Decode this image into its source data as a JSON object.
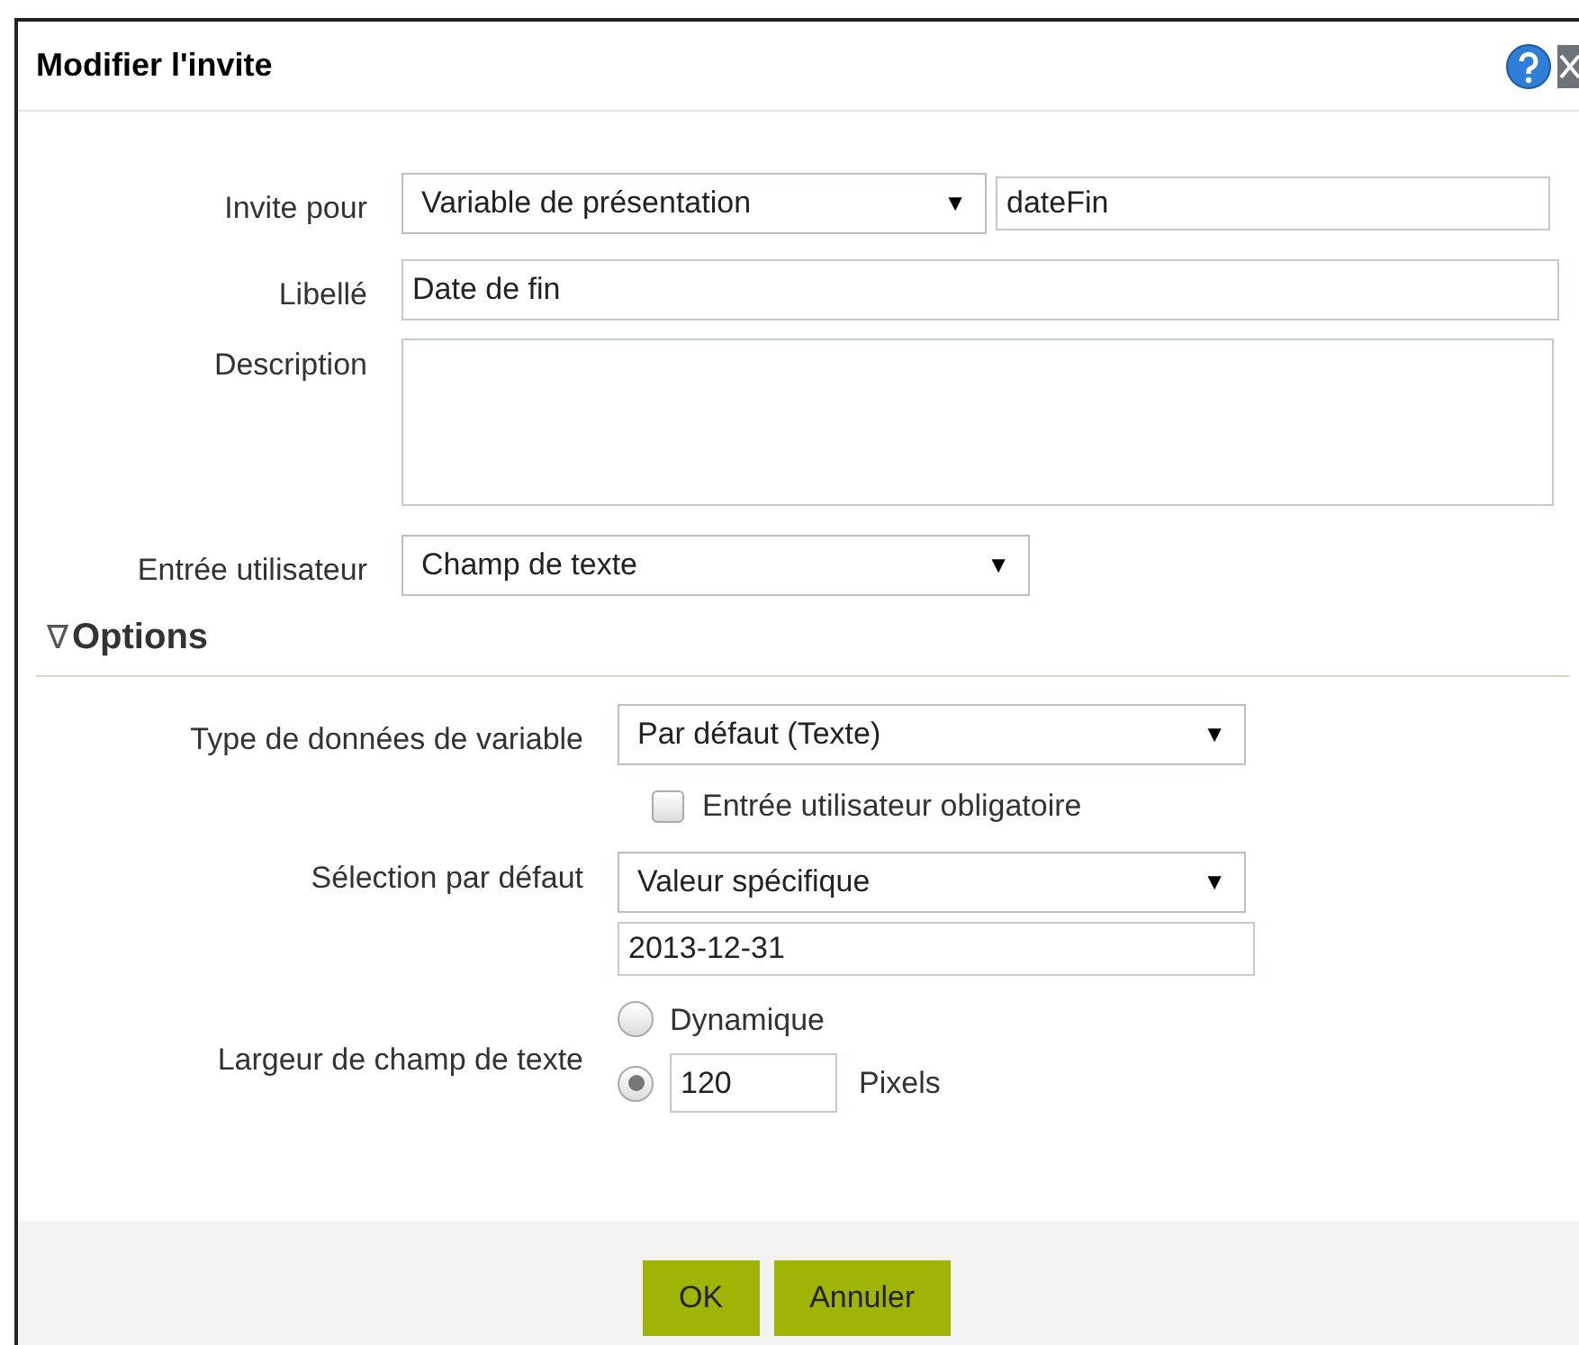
{
  "window": {
    "title": "Modifier l'invite"
  },
  "fields": {
    "prompt_for": {
      "label": "Invite pour",
      "select": "Variable de présentation",
      "arrow": "▼",
      "value": "dateFin"
    },
    "label": {
      "label": "Libellé",
      "value": "Date de fin"
    },
    "description": {
      "label": "Description"
    },
    "user_input": {
      "label": "Entrée utilisateur",
      "select": "Champ de texte",
      "arrow": "▼"
    }
  },
  "options": {
    "title": "Options",
    "toggle": "∇",
    "expanded": true,
    "data_type": {
      "label": "Type de données de variable",
      "select": "Par défaut (Texte)",
      "arrow": "▼"
    },
    "required": {
      "label": "Entrée utilisateur obligatoire",
      "checked": false
    },
    "default_selection": {
      "label": "Sélection par défaut",
      "select": "Valeur spécifique",
      "arrow": "▼",
      "value": "2013-12-31"
    },
    "text_width": {
      "label": "Largeur de champ de texte",
      "choices": [
        {
          "label": "Dynamique",
          "selected": false
        },
        {
          "value": "120",
          "unit": "Pixels",
          "selected": true
        }
      ]
    }
  },
  "buttons": [
    "OK",
    "Annuler"
  ]
}
